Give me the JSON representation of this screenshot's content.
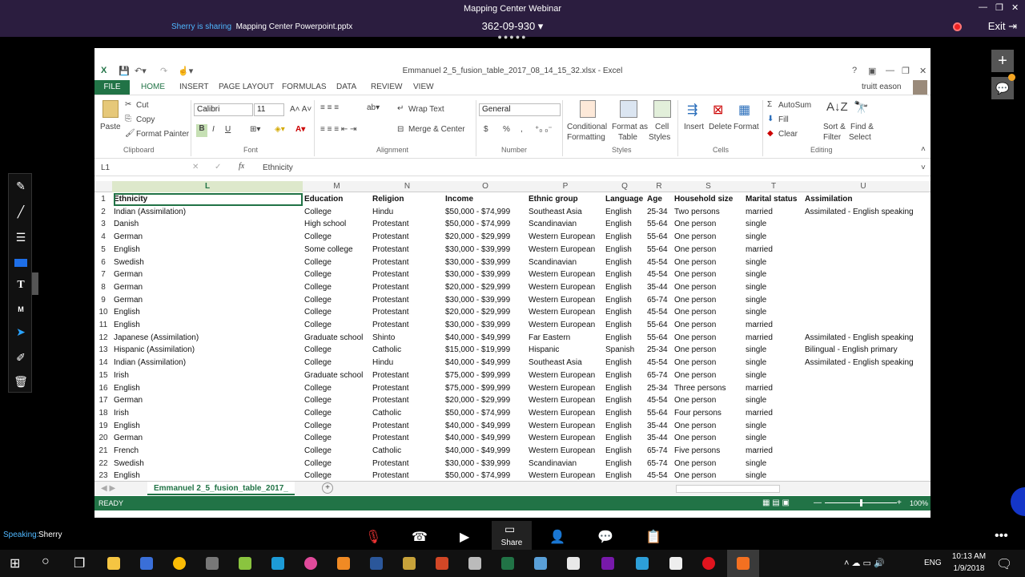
{
  "webinar": {
    "title": "Mapping Center Webinar",
    "sharing_label": "Sherry is sharing",
    "sharing_file": "Mapping Center Powerpoint.pptx",
    "meeting_id": "362-09-930 ▾",
    "exit_label": "Exit",
    "speaking_label": "Speaking:",
    "speaker": "Sherry",
    "share_label": "Share"
  },
  "excel": {
    "window_title": "Emmanuel 2_5_fusion_table_2017_08_14_15_32.xlsx - Excel",
    "user": "truitt eason",
    "tabs": [
      "FILE",
      "HOME",
      "INSERT",
      "PAGE LAYOUT",
      "FORMULAS",
      "DATA",
      "REVIEW",
      "VIEW"
    ],
    "clipboard": {
      "paste": "Paste",
      "cut": "Cut",
      "copy": "Copy",
      "format_painter": "Format Painter",
      "group": "Clipboard"
    },
    "font": {
      "name": "Calibri",
      "size": "11",
      "bold": "B",
      "italic": "I",
      "underline": "U",
      "group": "Font"
    },
    "alignment": {
      "wrap": "Wrap Text",
      "merge": "Merge & Center",
      "group": "Alignment"
    },
    "number": {
      "format": "General",
      "currency": "$",
      "percent": "%",
      "comma": ",",
      "group": "Number"
    },
    "styles": {
      "conditional": "Conditional",
      "conditional2": "Formatting",
      "format_as": "Format as",
      "table": "Table",
      "cell": "Cell",
      "styles": "Styles",
      "group": "Styles"
    },
    "cells": {
      "insert": "Insert",
      "delete": "Delete",
      "format": "Format",
      "group": "Cells"
    },
    "editing": {
      "autosum": "AutoSum",
      "fill": "Fill",
      "clear": "Clear",
      "sort": "Sort &",
      "filter": "Filter",
      "find": "Find &",
      "select": "Select",
      "group": "Editing"
    },
    "name_box": "L1",
    "formula": "Ethnicity",
    "columns": [
      "L",
      "M",
      "N",
      "O",
      "P",
      "Q",
      "R",
      "S",
      "T",
      "U"
    ],
    "headers": [
      "Ethnicity",
      "Education",
      "Religion",
      "Income",
      "Ethnic group",
      "Language",
      "Age",
      "Household size",
      "Marital status",
      "Assimilation"
    ],
    "rows": [
      [
        "2",
        "Indian (Assimilation)",
        "College",
        "Hindu",
        "$50,000 - $74,999",
        "Southeast Asia",
        "English",
        "25-34",
        "Two persons",
        "married",
        "Assimilated - English speaking"
      ],
      [
        "3",
        "Danish",
        "High school",
        "Protestant",
        "$50,000 - $74,999",
        "Scandinavian",
        "English",
        "55-64",
        "One person",
        "single",
        ""
      ],
      [
        "4",
        "German",
        "College",
        "Protestant",
        "$20,000 - $29,999",
        "Western European",
        "English",
        "55-64",
        "One person",
        "single",
        ""
      ],
      [
        "5",
        "English",
        "Some college",
        "Protestant",
        "$30,000 - $39,999",
        "Western European",
        "English",
        "55-64",
        "One person",
        "married",
        ""
      ],
      [
        "6",
        "Swedish",
        "College",
        "Protestant",
        "$30,000 - $39,999",
        "Scandinavian",
        "English",
        "45-54",
        "One person",
        "single",
        ""
      ],
      [
        "7",
        "German",
        "College",
        "Protestant",
        "$30,000 - $39,999",
        "Western European",
        "English",
        "45-54",
        "One person",
        "single",
        ""
      ],
      [
        "8",
        "German",
        "College",
        "Protestant",
        "$20,000 - $29,999",
        "Western European",
        "English",
        "35-44",
        "One person",
        "single",
        ""
      ],
      [
        "9",
        "German",
        "College",
        "Protestant",
        "$30,000 - $39,999",
        "Western European",
        "English",
        "65-74",
        "One person",
        "single",
        ""
      ],
      [
        "10",
        "English",
        "College",
        "Protestant",
        "$20,000 - $29,999",
        "Western European",
        "English",
        "45-54",
        "One person",
        "single",
        ""
      ],
      [
        "11",
        "English",
        "College",
        "Protestant",
        "$30,000 - $39,999",
        "Western European",
        "English",
        "55-64",
        "One person",
        "married",
        ""
      ],
      [
        "12",
        "Japanese (Assimilation)",
        "Graduate school",
        "Shinto",
        "$40,000 - $49,999",
        "Far Eastern",
        "English",
        "55-64",
        "One person",
        "married",
        "Assimilated - English speaking"
      ],
      [
        "13",
        "Hispanic (Assimilation)",
        "College",
        "Catholic",
        "$15,000 - $19,999",
        "Hispanic",
        "Spanish",
        "25-34",
        "One person",
        "single",
        "Bilingual - English primary"
      ],
      [
        "14",
        "Indian (Assimilation)",
        "College",
        "Hindu",
        "$40,000 - $49,999",
        "Southeast Asia",
        "English",
        "45-54",
        "One person",
        "single",
        "Assimilated - English speaking"
      ],
      [
        "15",
        "Irish",
        "Graduate school",
        "Protestant",
        "$75,000 - $99,999",
        "Western European",
        "English",
        "65-74",
        "One person",
        "single",
        ""
      ],
      [
        "16",
        "English",
        "College",
        "Protestant",
        "$75,000 - $99,999",
        "Western European",
        "English",
        "25-34",
        "Three persons",
        "married",
        ""
      ],
      [
        "17",
        "German",
        "College",
        "Protestant",
        "$20,000 - $29,999",
        "Western European",
        "English",
        "45-54",
        "One person",
        "single",
        ""
      ],
      [
        "18",
        "Irish",
        "College",
        "Catholic",
        "$50,000 - $74,999",
        "Western European",
        "English",
        "55-64",
        "Four persons",
        "married",
        ""
      ],
      [
        "19",
        "English",
        "College",
        "Protestant",
        "$40,000 - $49,999",
        "Western European",
        "English",
        "35-44",
        "One person",
        "single",
        ""
      ],
      [
        "20",
        "German",
        "College",
        "Protestant",
        "$40,000 - $49,999",
        "Western European",
        "English",
        "35-44",
        "One person",
        "single",
        ""
      ],
      [
        "21",
        "French",
        "College",
        "Catholic",
        "$40,000 - $49,999",
        "Western European",
        "English",
        "65-74",
        "Five persons",
        "married",
        ""
      ],
      [
        "22",
        "Swedish",
        "College",
        "Protestant",
        "$30,000 - $39,999",
        "Scandinavian",
        "English",
        "65-74",
        "One person",
        "single",
        ""
      ],
      [
        "23",
        "English",
        "College",
        "Protestant",
        "$50,000 - $74,999",
        "Western European",
        "English",
        "45-54",
        "One person",
        "single",
        ""
      ]
    ],
    "sheet_tab": "Emmanuel 2_5_fusion_table_2017_",
    "status": "READY",
    "zoom": "100%"
  },
  "taskbar": {
    "time": "10:13 AM",
    "date": "1/9/2018",
    "lang": "ENG"
  },
  "colors": {
    "excel_green": "#217346",
    "webinar_bar": "#2b1d3f"
  }
}
